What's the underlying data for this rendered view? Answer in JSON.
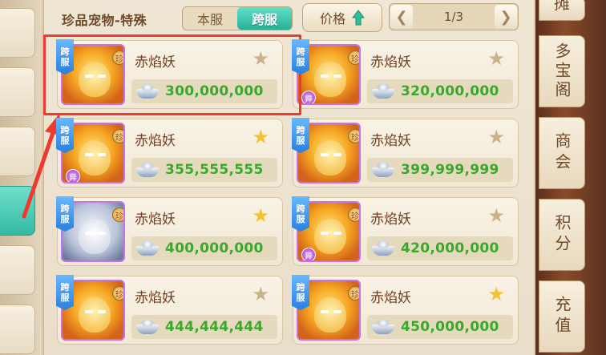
{
  "header": {
    "title": "珍品宠物-特殊",
    "toggle": {
      "left": "本服",
      "right": "跨服",
      "active": "right"
    },
    "price_sort_label": "价格",
    "page": "1/3"
  },
  "tags": {
    "cross_server": [
      "跨",
      "服"
    ],
    "rare": "珍",
    "mutant": "异"
  },
  "listings": [
    {
      "name": "赤焰妖",
      "price": "300,000,000",
      "starred": false,
      "portrait": "golden",
      "cross": true,
      "mutant": false
    },
    {
      "name": "赤焰妖",
      "price": "320,000,000",
      "starred": false,
      "portrait": "golden",
      "cross": true,
      "mutant": true
    },
    {
      "name": "赤焰妖",
      "price": "355,555,555",
      "starred": true,
      "portrait": "golden",
      "cross": true,
      "mutant": true
    },
    {
      "name": "赤焰妖",
      "price": "399,999,999",
      "starred": false,
      "portrait": "golden",
      "cross": true,
      "mutant": false
    },
    {
      "name": "赤焰妖",
      "price": "400,000,000",
      "starred": true,
      "portrait": "silver",
      "cross": true,
      "mutant": false
    },
    {
      "name": "赤焰妖",
      "price": "420,000,000",
      "starred": false,
      "portrait": "golden",
      "cross": true,
      "mutant": true
    },
    {
      "name": "赤焰妖",
      "price": "444,444,444",
      "starred": false,
      "portrait": "golden",
      "cross": true,
      "mutant": false
    },
    {
      "name": "赤焰妖",
      "price": "450,000,000",
      "starred": true,
      "portrait": "golden",
      "cross": true,
      "mutant": false
    }
  ],
  "right_tabs": [
    {
      "label": "摊",
      "active": true
    },
    {
      "label": "多宝阁",
      "active": false
    },
    {
      "label": "商会",
      "active": false
    },
    {
      "label": "积分",
      "active": false
    },
    {
      "label": "充值",
      "active": false
    }
  ],
  "colors": {
    "price_green": "#3aa82c",
    "accent_teal": "#26b196",
    "highlight_red": "#ee3a2e"
  },
  "icons": {
    "star": "star-icon",
    "currency": "silver-ingot-icon",
    "sort": "arrow-up-icon"
  }
}
